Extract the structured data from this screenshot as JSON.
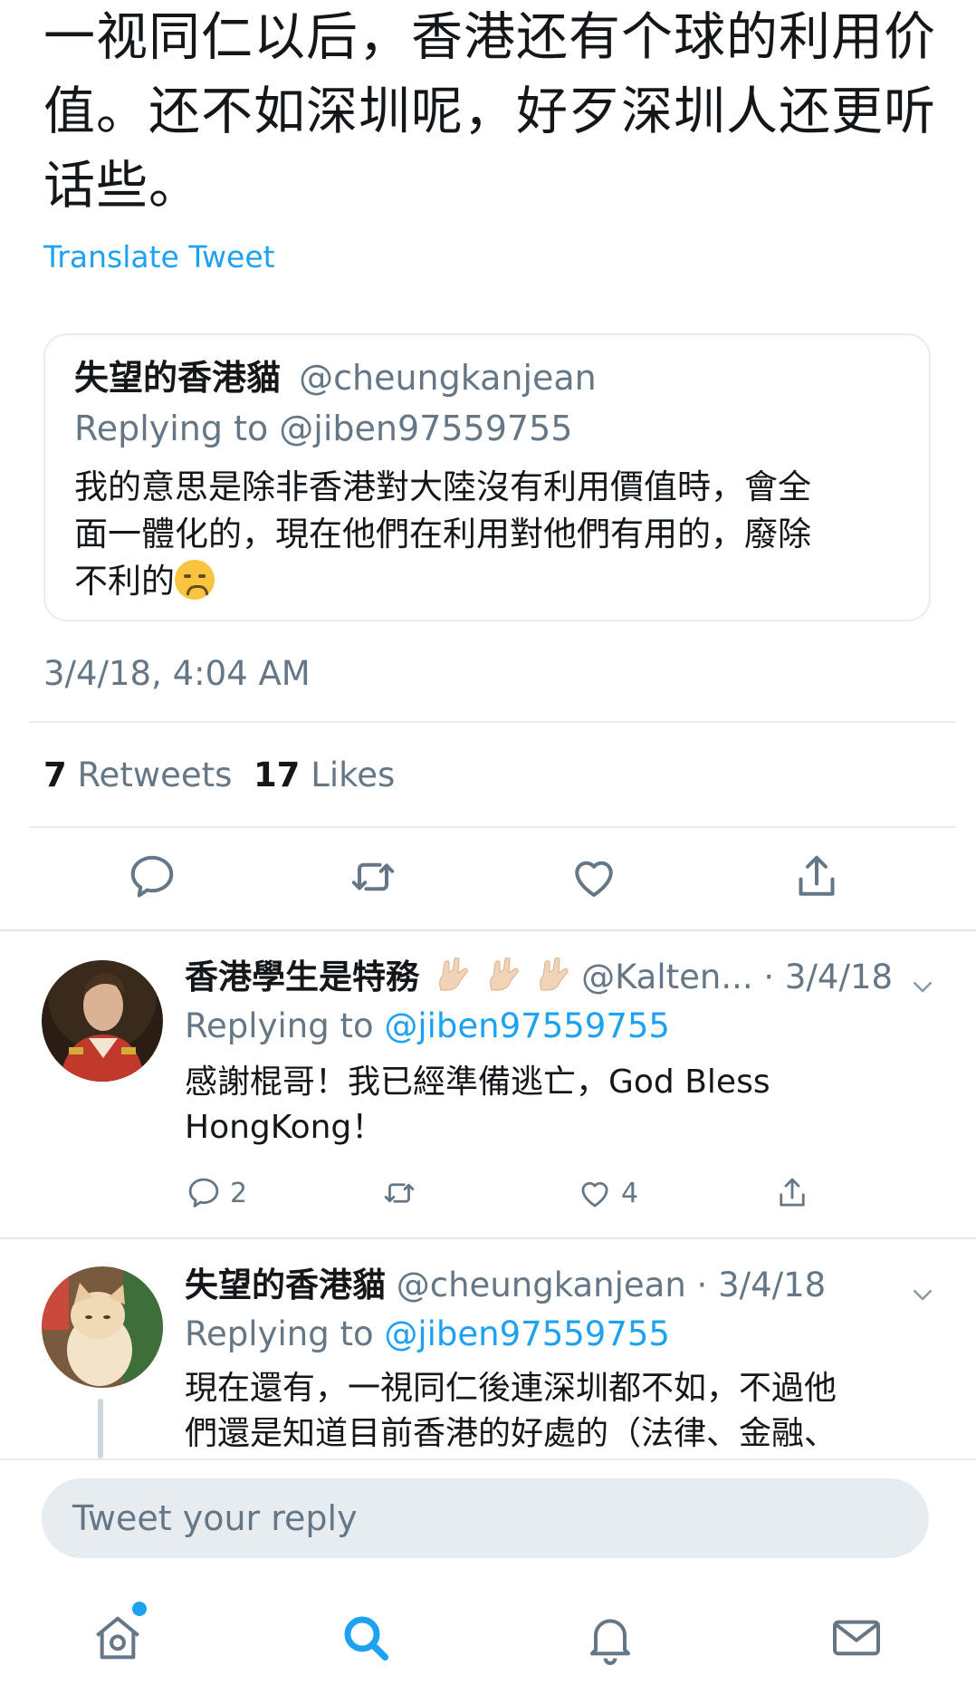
{
  "tweet": {
    "text_lines": [
      "一视同仁以后，香港还有个球的利用价",
      "值。还不如深圳呢，好歹深圳人还更听",
      "话些。"
    ],
    "translate_label": "Translate Tweet",
    "timestamp": "3/4/18, 4:04 AM",
    "retweets_count": "7",
    "retweets_label": "Retweets",
    "likes_count": "17",
    "likes_label": "Likes"
  },
  "quote": {
    "name": "失望的香港貓",
    "handle": "@cheungkanjean",
    "replying": "Replying to @jiben97559755",
    "body_lines": [
      "我的意思是除非香港對大陸沒有利用價值時，會全",
      "面一體化的，現在他們在利用對他們有用的，廢除",
      "不利的"
    ],
    "emoji": "disappointed-face"
  },
  "actions": [
    "reply-icon",
    "retweet-icon",
    "like-icon",
    "share-icon"
  ],
  "replies": [
    {
      "name": "香港學生是特務",
      "name_emoji": "i-love-you-hand-sign",
      "handle": "@Kalten...",
      "date": "· 3/4/18",
      "replying_prefix": "Replying to ",
      "replying_mention": "@jiben97559755",
      "body_lines": [
        "感謝棍哥！我已經準備逃亡，God Bless",
        "HongKong！"
      ],
      "reply_count": "2",
      "retweet_count": "",
      "like_count": "4"
    },
    {
      "name": "失望的香港貓",
      "handle": "@cheungkanjean",
      "date": "· 3/4/18",
      "replying_prefix": "Replying to ",
      "replying_mention": "@jiben97559755",
      "body_lines": [
        "現在還有，一視同仁後連深圳都不如，不過他",
        "們還是知道目前香港的好處的（法律、金融、"
      ]
    }
  ],
  "reply_box": {
    "placeholder": "Tweet your reply"
  },
  "tabbar": [
    "home-icon",
    "search-icon",
    "notifications-icon",
    "messages-icon"
  ],
  "colors": {
    "accent": "#1da1f2",
    "text": "#14171a",
    "secondary": "#657786",
    "border": "#e6ecf0"
  }
}
